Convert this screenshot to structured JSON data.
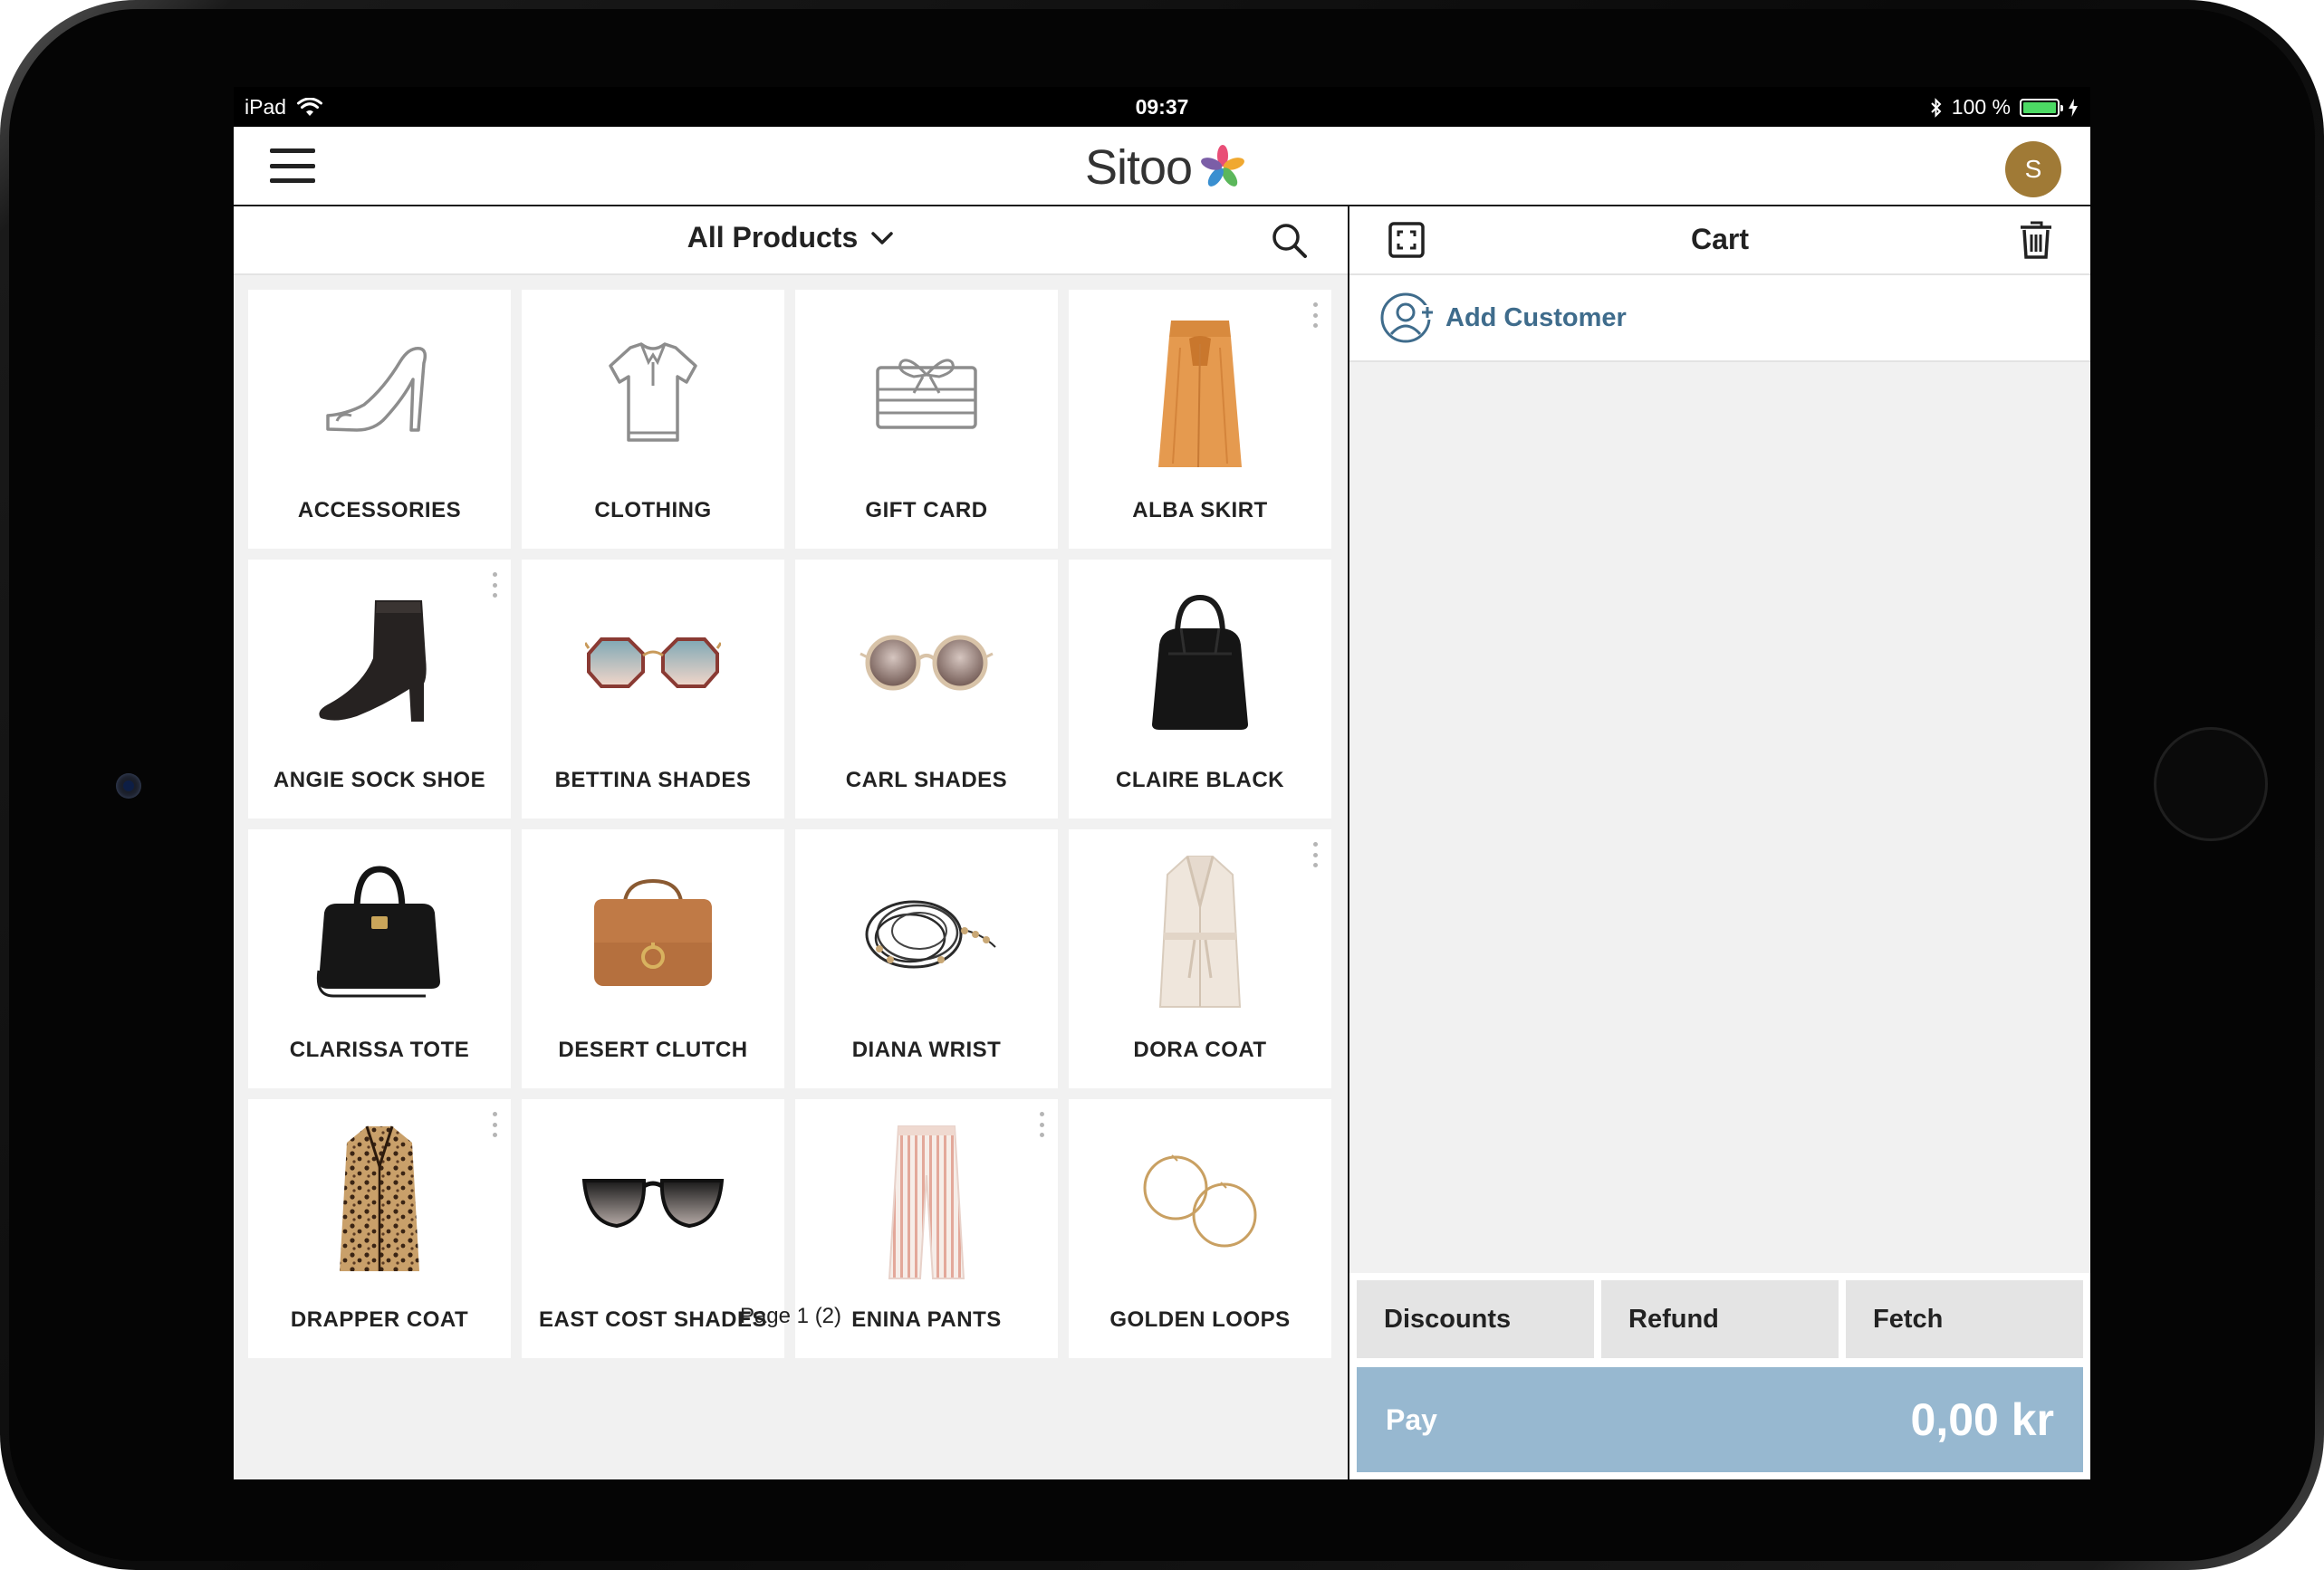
{
  "status_bar": {
    "device": "iPad",
    "time": "09:37",
    "battery": "100 %",
    "battery_level": 1.0
  },
  "header": {
    "logo_text": "Sitoo",
    "avatar_initial": "S"
  },
  "products": {
    "category": "All Products",
    "page": "Page 1 (2)",
    "tiles": [
      {
        "label": "ACCESSORIES",
        "icon": "shoe-outline-icon",
        "has_menu": false
      },
      {
        "label": "CLOTHING",
        "icon": "shirt-outline-icon",
        "has_menu": false
      },
      {
        "label": "GIFT CARD",
        "icon": "gift-card-outline-icon",
        "has_menu": false
      },
      {
        "label": "ALBA SKIRT",
        "icon": "skirt-image",
        "has_menu": true
      },
      {
        "label": "ANGIE SOCK SHOE",
        "icon": "boot-image",
        "has_menu": true
      },
      {
        "label": "BETTINA SHADES",
        "icon": "octagon-sunglasses-image",
        "has_menu": false
      },
      {
        "label": "CARL SHADES",
        "icon": "round-sunglasses-image",
        "has_menu": false
      },
      {
        "label": "CLAIRE BLACK",
        "icon": "black-bag-image",
        "has_menu": false
      },
      {
        "label": "CLARISSA TOTE",
        "icon": "tote-bag-image",
        "has_menu": false
      },
      {
        "label": "DESERT CLUTCH",
        "icon": "brown-bag-image",
        "has_menu": false
      },
      {
        "label": "DIANA WRIST",
        "icon": "bracelet-image",
        "has_menu": false
      },
      {
        "label": "DORA COAT",
        "icon": "white-coat-image",
        "has_menu": true
      },
      {
        "label": "DRAPPER COAT",
        "icon": "leopard-coat-image",
        "has_menu": true
      },
      {
        "label": "EAST COST SHADES",
        "icon": "black-sunglasses-image",
        "has_menu": false
      },
      {
        "label": "ENINA PANTS",
        "icon": "striped-pants-image",
        "has_menu": true
      },
      {
        "label": "GOLDEN LOOPS",
        "icon": "hoop-earrings-image",
        "has_menu": false
      }
    ]
  },
  "cart": {
    "title": "Cart",
    "add_customer": "Add Customer",
    "actions": {
      "discounts": "Discounts",
      "refund": "Refund",
      "fetch": "Fetch"
    },
    "pay_label": "Pay",
    "total": "0,00 kr"
  },
  "colors": {
    "accent_blue": "#3f6c8c",
    "pay_button": "#97b8d0",
    "avatar": "#a07a36",
    "panel_bg": "#f1f1f1"
  }
}
